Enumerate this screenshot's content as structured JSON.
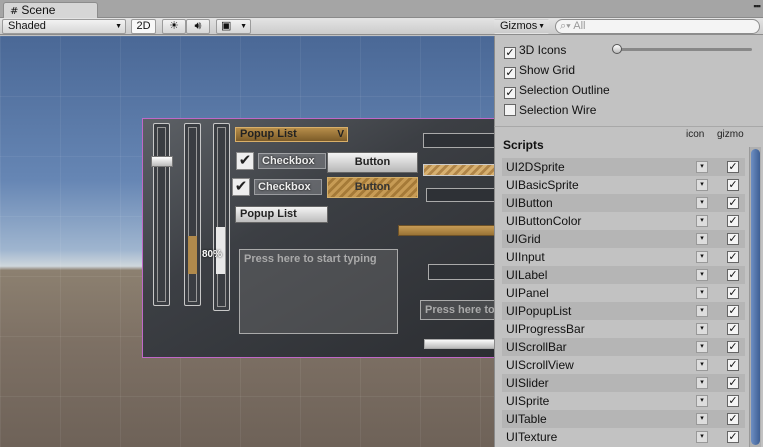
{
  "tab": {
    "title": "Scene"
  },
  "toolbar": {
    "shading": "Shaded",
    "mode_2d": "2D",
    "gizmos": "Gizmos",
    "search_placeholder": "All"
  },
  "scene": {
    "popup_label": "Popup List",
    "popup_arrow": "V",
    "checkbox_1": "Checkbox",
    "checkbox_2": "Checkbox",
    "button_1": "Button",
    "button_2": "Button",
    "popup_2": "Popup List",
    "percent": "80%",
    "textarea_placeholder": "Press here to start typing",
    "input_placeholder": "Press here to"
  },
  "gizmos": {
    "options": [
      {
        "label": "3D Icons",
        "checked": true
      },
      {
        "label": "Show Grid",
        "checked": true
      },
      {
        "label": "Selection Outline",
        "checked": true
      },
      {
        "label": "Selection Wire",
        "checked": false
      }
    ],
    "scripts_header": "Scripts",
    "col_icon": "icon",
    "col_gizmo": "gizmo",
    "scripts": [
      "UI2DSprite",
      "UIBasicSprite",
      "UIButton",
      "UIButtonColor",
      "UIGrid",
      "UIInput",
      "UILabel",
      "UIPanel",
      "UIPopupList",
      "UIProgressBar",
      "UIScrollBar",
      "UIScrollView",
      "UISlider",
      "UISprite",
      "UITable",
      "UITexture"
    ]
  },
  "icons": {
    "tab": "grid-icon",
    "sun": "sun-icon",
    "audio": "speaker-icon",
    "effects": "image-icon",
    "search": "search-icon"
  }
}
